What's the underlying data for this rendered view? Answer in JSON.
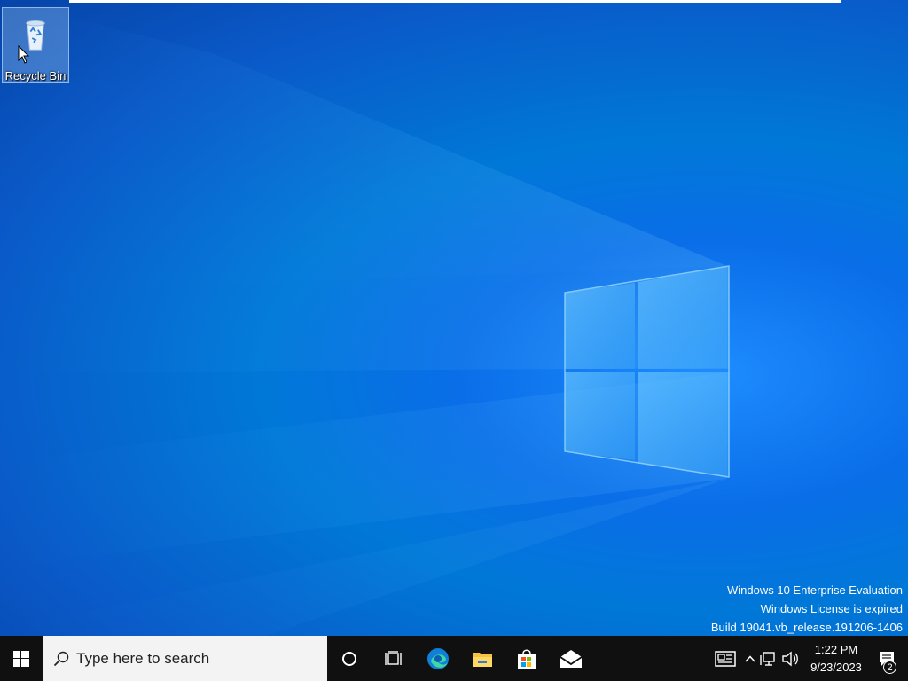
{
  "desktop": {
    "icons": [
      {
        "label": "Recycle Bin",
        "icon": "recycle-bin-icon"
      }
    ]
  },
  "watermark": {
    "line1": "Windows 10 Enterprise Evaluation",
    "line2": "Windows License is expired",
    "line3": "Build 19041.vb_release.191206-1406"
  },
  "taskbar": {
    "start_icon": "windows-logo-icon",
    "search": {
      "placeholder": "Type here to search"
    },
    "apps": [
      {
        "name": "cortana-icon"
      },
      {
        "name": "task-view-icon"
      },
      {
        "name": "edge-icon"
      },
      {
        "name": "file-explorer-icon"
      },
      {
        "name": "microsoft-store-icon"
      },
      {
        "name": "mail-icon"
      }
    ],
    "tray": {
      "time": "1:22 PM",
      "date": "9/23/2023",
      "notification_count": "2"
    }
  },
  "colors": {
    "wallpaper_blue": "#0078d7",
    "taskbar_bg": "#101010",
    "search_bg": "#f3f3f3"
  }
}
